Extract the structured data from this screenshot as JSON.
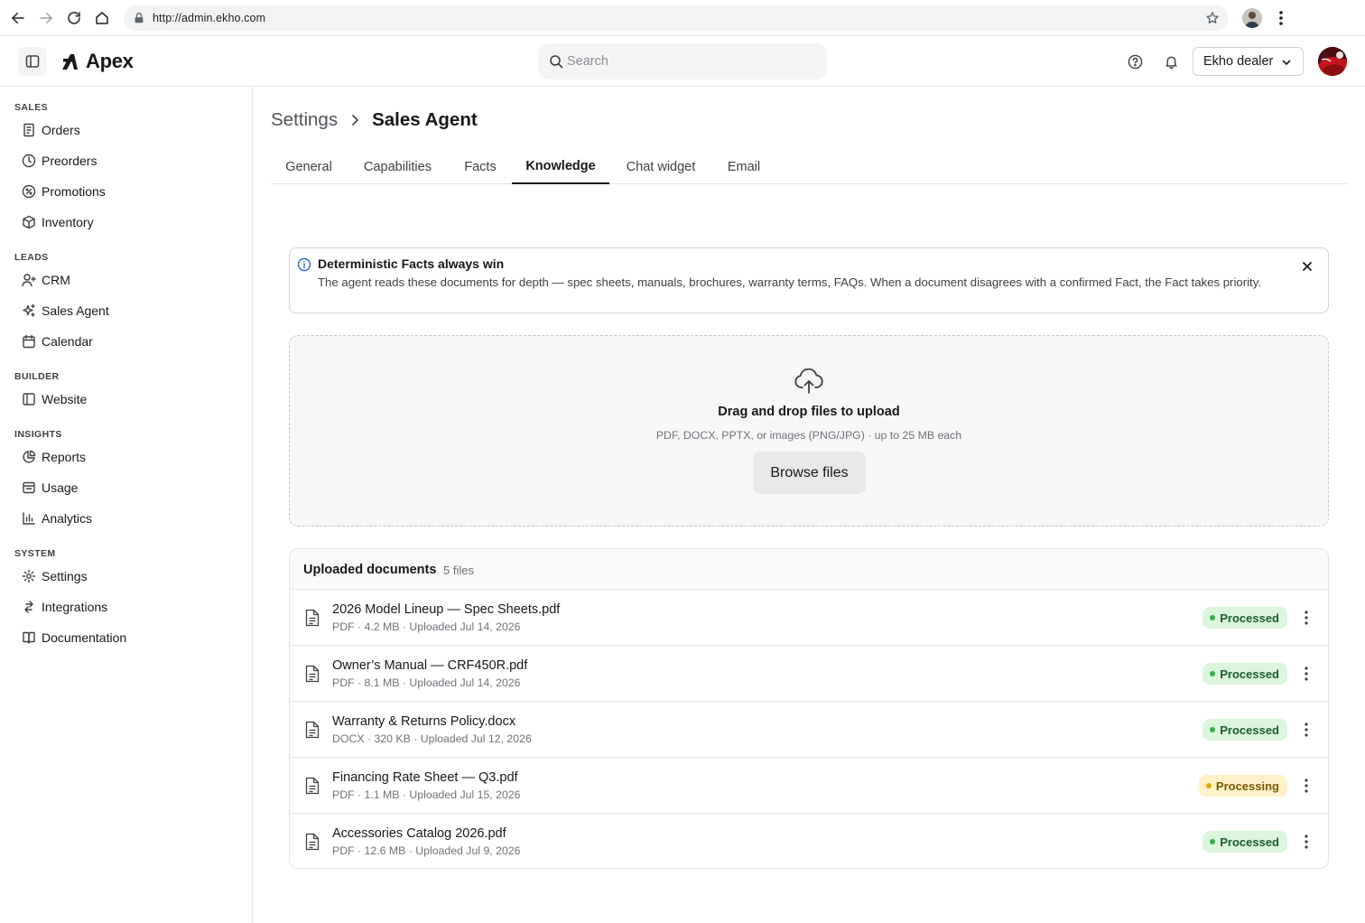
{
  "browser": {
    "url": "http://admin.ekho.com"
  },
  "header": {
    "app_name": "Apex",
    "search_placeholder": "Search",
    "dealer": "Ekho dealer"
  },
  "sidebar": {
    "sections": [
      {
        "title": "SALES",
        "items": [
          {
            "label": "Orders",
            "icon": "orders-icon"
          },
          {
            "label": "Preorders",
            "icon": "clock-icon"
          },
          {
            "label": "Promotions",
            "icon": "promotion-icon"
          },
          {
            "label": "Inventory",
            "icon": "box-icon"
          }
        ]
      },
      {
        "title": "LEADS",
        "items": [
          {
            "label": "CRM",
            "icon": "user-plus-icon"
          },
          {
            "label": "Sales Agent",
            "icon": "sparkles-icon"
          },
          {
            "label": "Calendar",
            "icon": "calendar-icon"
          }
        ]
      },
      {
        "title": "BUILDER",
        "items": [
          {
            "label": "Website",
            "icon": "layout-icon"
          }
        ]
      },
      {
        "title": "INSIGHTS",
        "items": [
          {
            "label": "Reports",
            "icon": "pie-chart-icon"
          },
          {
            "label": "Usage",
            "icon": "inbox-icon"
          },
          {
            "label": "Analytics",
            "icon": "bar-chart-icon"
          }
        ]
      },
      {
        "title": "SYSTEM",
        "items": [
          {
            "label": "Settings",
            "icon": "gear-icon"
          },
          {
            "label": "Integrations",
            "icon": "integrations-icon"
          },
          {
            "label": "Documentation",
            "icon": "book-icon"
          }
        ]
      }
    ]
  },
  "breadcrumb": {
    "root": "Settings",
    "current": "Sales Agent"
  },
  "tabs": [
    "General",
    "Capabilities",
    "Facts",
    "Knowledge",
    "Chat widget",
    "Email"
  ],
  "active_tab": "Knowledge",
  "banner": {
    "title": "Deterministic Facts always win",
    "text": "The agent reads these documents for depth — spec sheets, manuals, brochures, warranty terms, FAQs. When a document disagrees with a confirmed Fact, the Fact takes priority."
  },
  "upload": {
    "title": "Drag and drop files to upload",
    "subtitle": "PDF, DOCX, PPTX, or images (PNG/JPG) · up to 25 MB each",
    "button": "Browse files"
  },
  "documents": {
    "title": "Uploaded documents",
    "count": "5 files",
    "items": [
      {
        "name": "2026 Model Lineup — Spec Sheets.pdf",
        "meta": "PDF · 4.2 MB · Uploaded Jul 14, 2026",
        "status": "Processed"
      },
      {
        "name": "Owner’s Manual — CRF450R.pdf",
        "meta": "PDF · 8.1 MB · Uploaded Jul 14, 2026",
        "status": "Processed"
      },
      {
        "name": "Warranty & Returns Policy.docx",
        "meta": "DOCX · 320 KB · Uploaded Jul 12, 2026",
        "status": "Processed"
      },
      {
        "name": "Financing Rate Sheet — Q3.pdf",
        "meta": "PDF · 1.1 MB · Uploaded Jul 15, 2026",
        "status": "Processing"
      },
      {
        "name": "Accessories Catalog 2026.pdf",
        "meta": "PDF · 12.6 MB · Uploaded Jul 9, 2026",
        "status": "Processed"
      }
    ]
  },
  "colors": {
    "processed_bg": "#dcf5dc",
    "processed_text": "#1d5e2a",
    "processing_bg": "#fdf2c8",
    "processing_text": "#7a5900",
    "info_blue": "#2563eb"
  }
}
